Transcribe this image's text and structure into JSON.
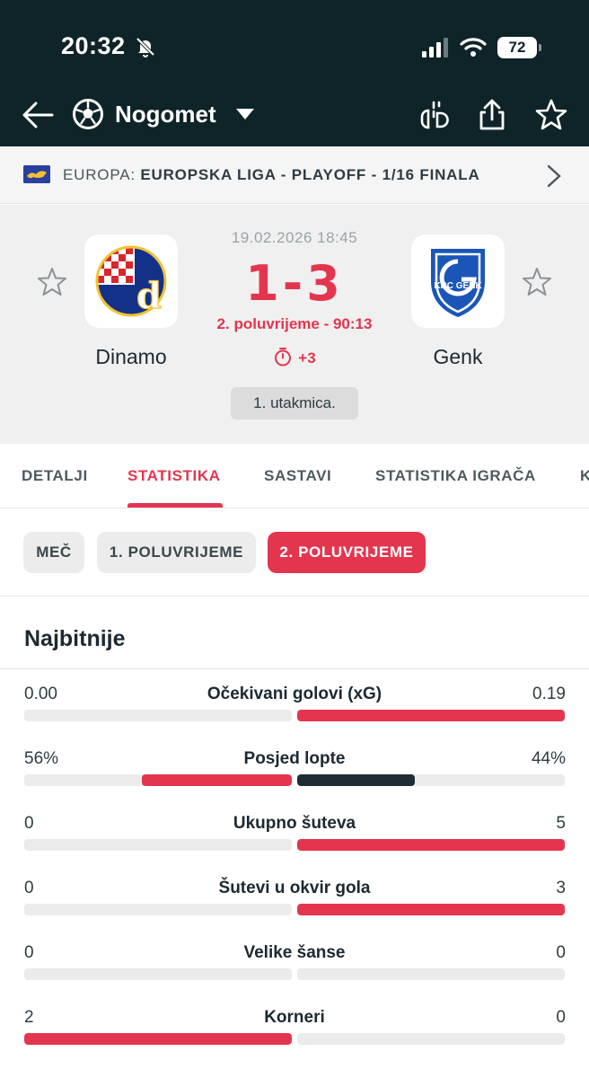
{
  "status_bar": {
    "time": "20:32",
    "battery": "72"
  },
  "header": {
    "sport": "Nogomet"
  },
  "competition": {
    "region": "EUROPA:",
    "name": "EUROPSKA LIGA - PLAYOFF - 1/16 FINALA"
  },
  "match": {
    "date": "19.02.2026 18:45",
    "score": "1-3",
    "period": "2. poluvrijeme - 90:13",
    "added_time": "+3",
    "leg": "1. utakmica.",
    "home": {
      "name": "Dinamo"
    },
    "away": {
      "name": "Genk",
      "crest_text": "KRC GENK"
    }
  },
  "tabs": [
    "DETALJI",
    "STATISTIKA",
    "SASTAVI",
    "STATISTIKA IGRAČA",
    "K"
  ],
  "active_tab": "STATISTIKA",
  "periods": [
    "MEČ",
    "1. POLUVRIJEME",
    "2. POLUVRIJEME"
  ],
  "active_period": "2. POLUVRIJEME",
  "section_title": "Najbitnije",
  "stats": [
    {
      "name": "Očekivani golovi (xG)",
      "home": "0.00",
      "away": "0.19",
      "home_share": 0.0,
      "away_share": 1.0,
      "home_color": "#e4354f",
      "away_color": "#e4354f"
    },
    {
      "name": "Posjed lopte",
      "home": "56%",
      "away": "44%",
      "home_share": 0.56,
      "away_share": 0.44,
      "home_color": "#e4354f",
      "away_color": "#1e2d33"
    },
    {
      "name": "Ukupno šuteva",
      "home": "0",
      "away": "5",
      "home_share": 0.0,
      "away_share": 1.0,
      "home_color": "#e4354f",
      "away_color": "#e4354f"
    },
    {
      "name": "Šutevi u okvir gola",
      "home": "0",
      "away": "3",
      "home_share": 0.0,
      "away_share": 1.0,
      "home_color": "#e4354f",
      "away_color": "#e4354f"
    },
    {
      "name": "Velike šanse",
      "home": "0",
      "away": "0",
      "home_share": 0.0,
      "away_share": 0.0,
      "home_color": "#e4354f",
      "away_color": "#e4354f"
    },
    {
      "name": "Korneri",
      "home": "2",
      "away": "0",
      "home_share": 1.0,
      "away_share": 0.0,
      "home_color": "#e4354f",
      "away_color": "#e4354f"
    }
  ],
  "colors": {
    "accent": "#e4354f",
    "header_bg": "#0f2429",
    "dark_bar": "#1e2d33"
  }
}
